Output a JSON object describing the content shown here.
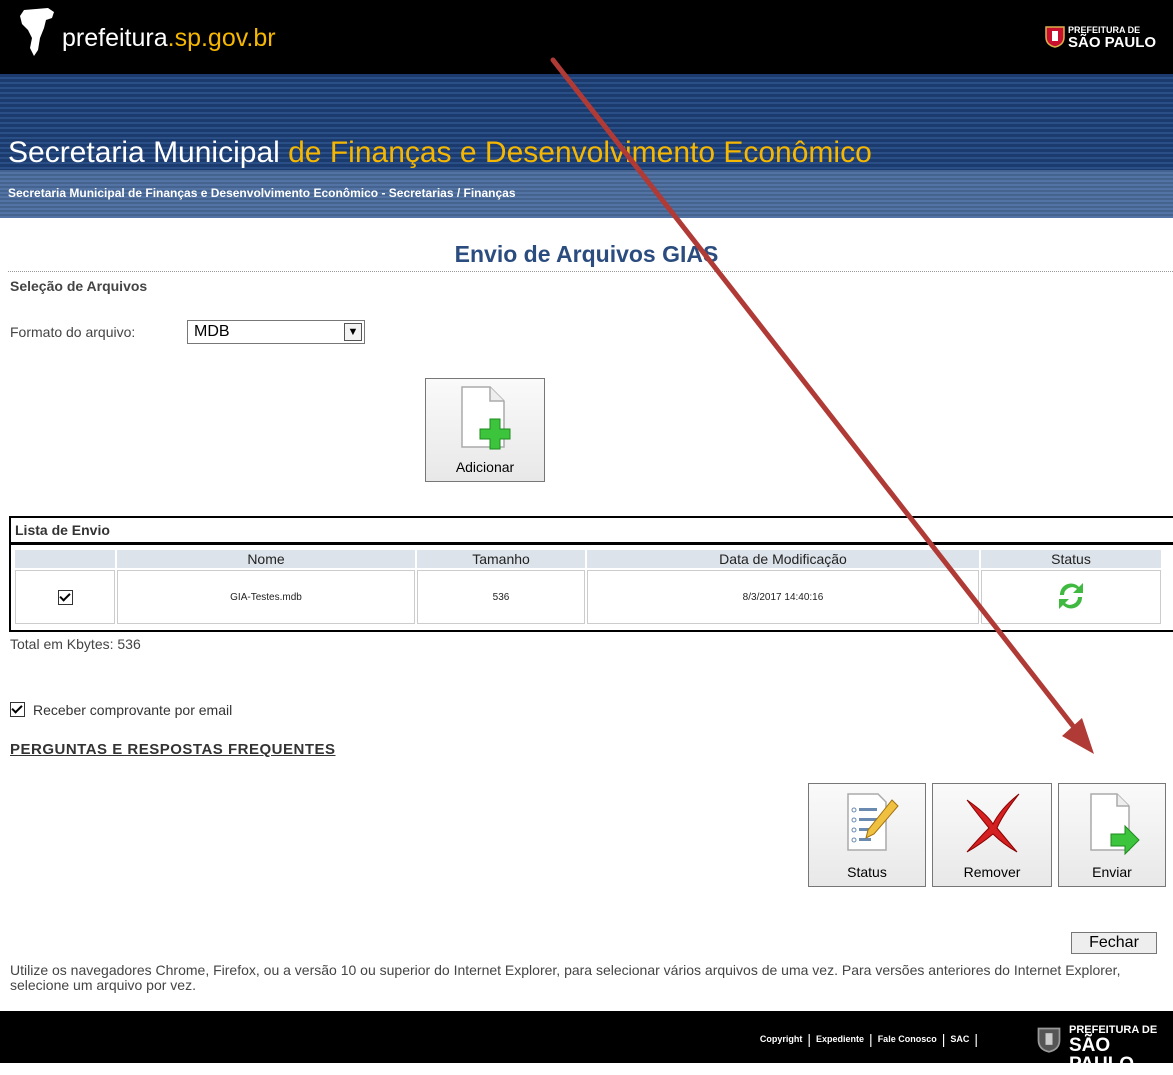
{
  "header": {
    "site_name_prefix": "prefeitura",
    "site_name_suffix": ".sp.gov.br",
    "brand_line1": "PREFEITURA DE",
    "brand_line2": "SÃO PAULO"
  },
  "banner": {
    "title_part1": "Secretaria Municipal ",
    "title_part2": "de Finanças e Desenvolvimento Econômico",
    "breadcrumb": "Secretaria Municipal de Finanças e Desenvolvimento Econômico - Secretarias / Finanças"
  },
  "page": {
    "title": "Envio de Arquivos GIAS",
    "selection_heading": "Seleção de Arquivos",
    "format_label": "Formato do arquivo:",
    "format_value": "MDB",
    "add_button": "Adicionar"
  },
  "send_list": {
    "title": "Lista de Envio",
    "columns": [
      "",
      "Nome",
      "Tamanho",
      "Data de Modificação",
      "Status"
    ],
    "rows": [
      {
        "checked": true,
        "name": "GIA-Testes.mdb",
        "size": "536",
        "modified": "8/3/2017 14:40:16",
        "status_icon": "refresh-icon"
      }
    ],
    "total": "Total em Kbytes: 536"
  },
  "options": {
    "email_receipt_label": "Receber comprovante por email",
    "email_receipt_checked": true,
    "faq_link": "PERGUNTAS E RESPOSTAS FREQUENTES"
  },
  "actions": {
    "status": "Status",
    "remove": "Remover",
    "send": "Enviar",
    "close": "Fechar"
  },
  "note": "Utilize os navegadores Chrome, Firefox, ou a versão 10 ou superior do Internet Explorer, para selecionar vários arquivos de uma vez. Para versões anteriores do Internet Explorer, selecione um arquivo por vez.",
  "footer": {
    "links": [
      "Copyright",
      "Expediente",
      "Fale Conosco",
      "SAC"
    ],
    "brand_line1": "PREFEITURA DE",
    "brand_line2": "SÃO PAULO"
  },
  "colors": {
    "accent": "#f5b700",
    "header_blue": "#1b3a6e",
    "title_blue": "#2b4c7e",
    "annotation_arrow": "#b03a35"
  }
}
